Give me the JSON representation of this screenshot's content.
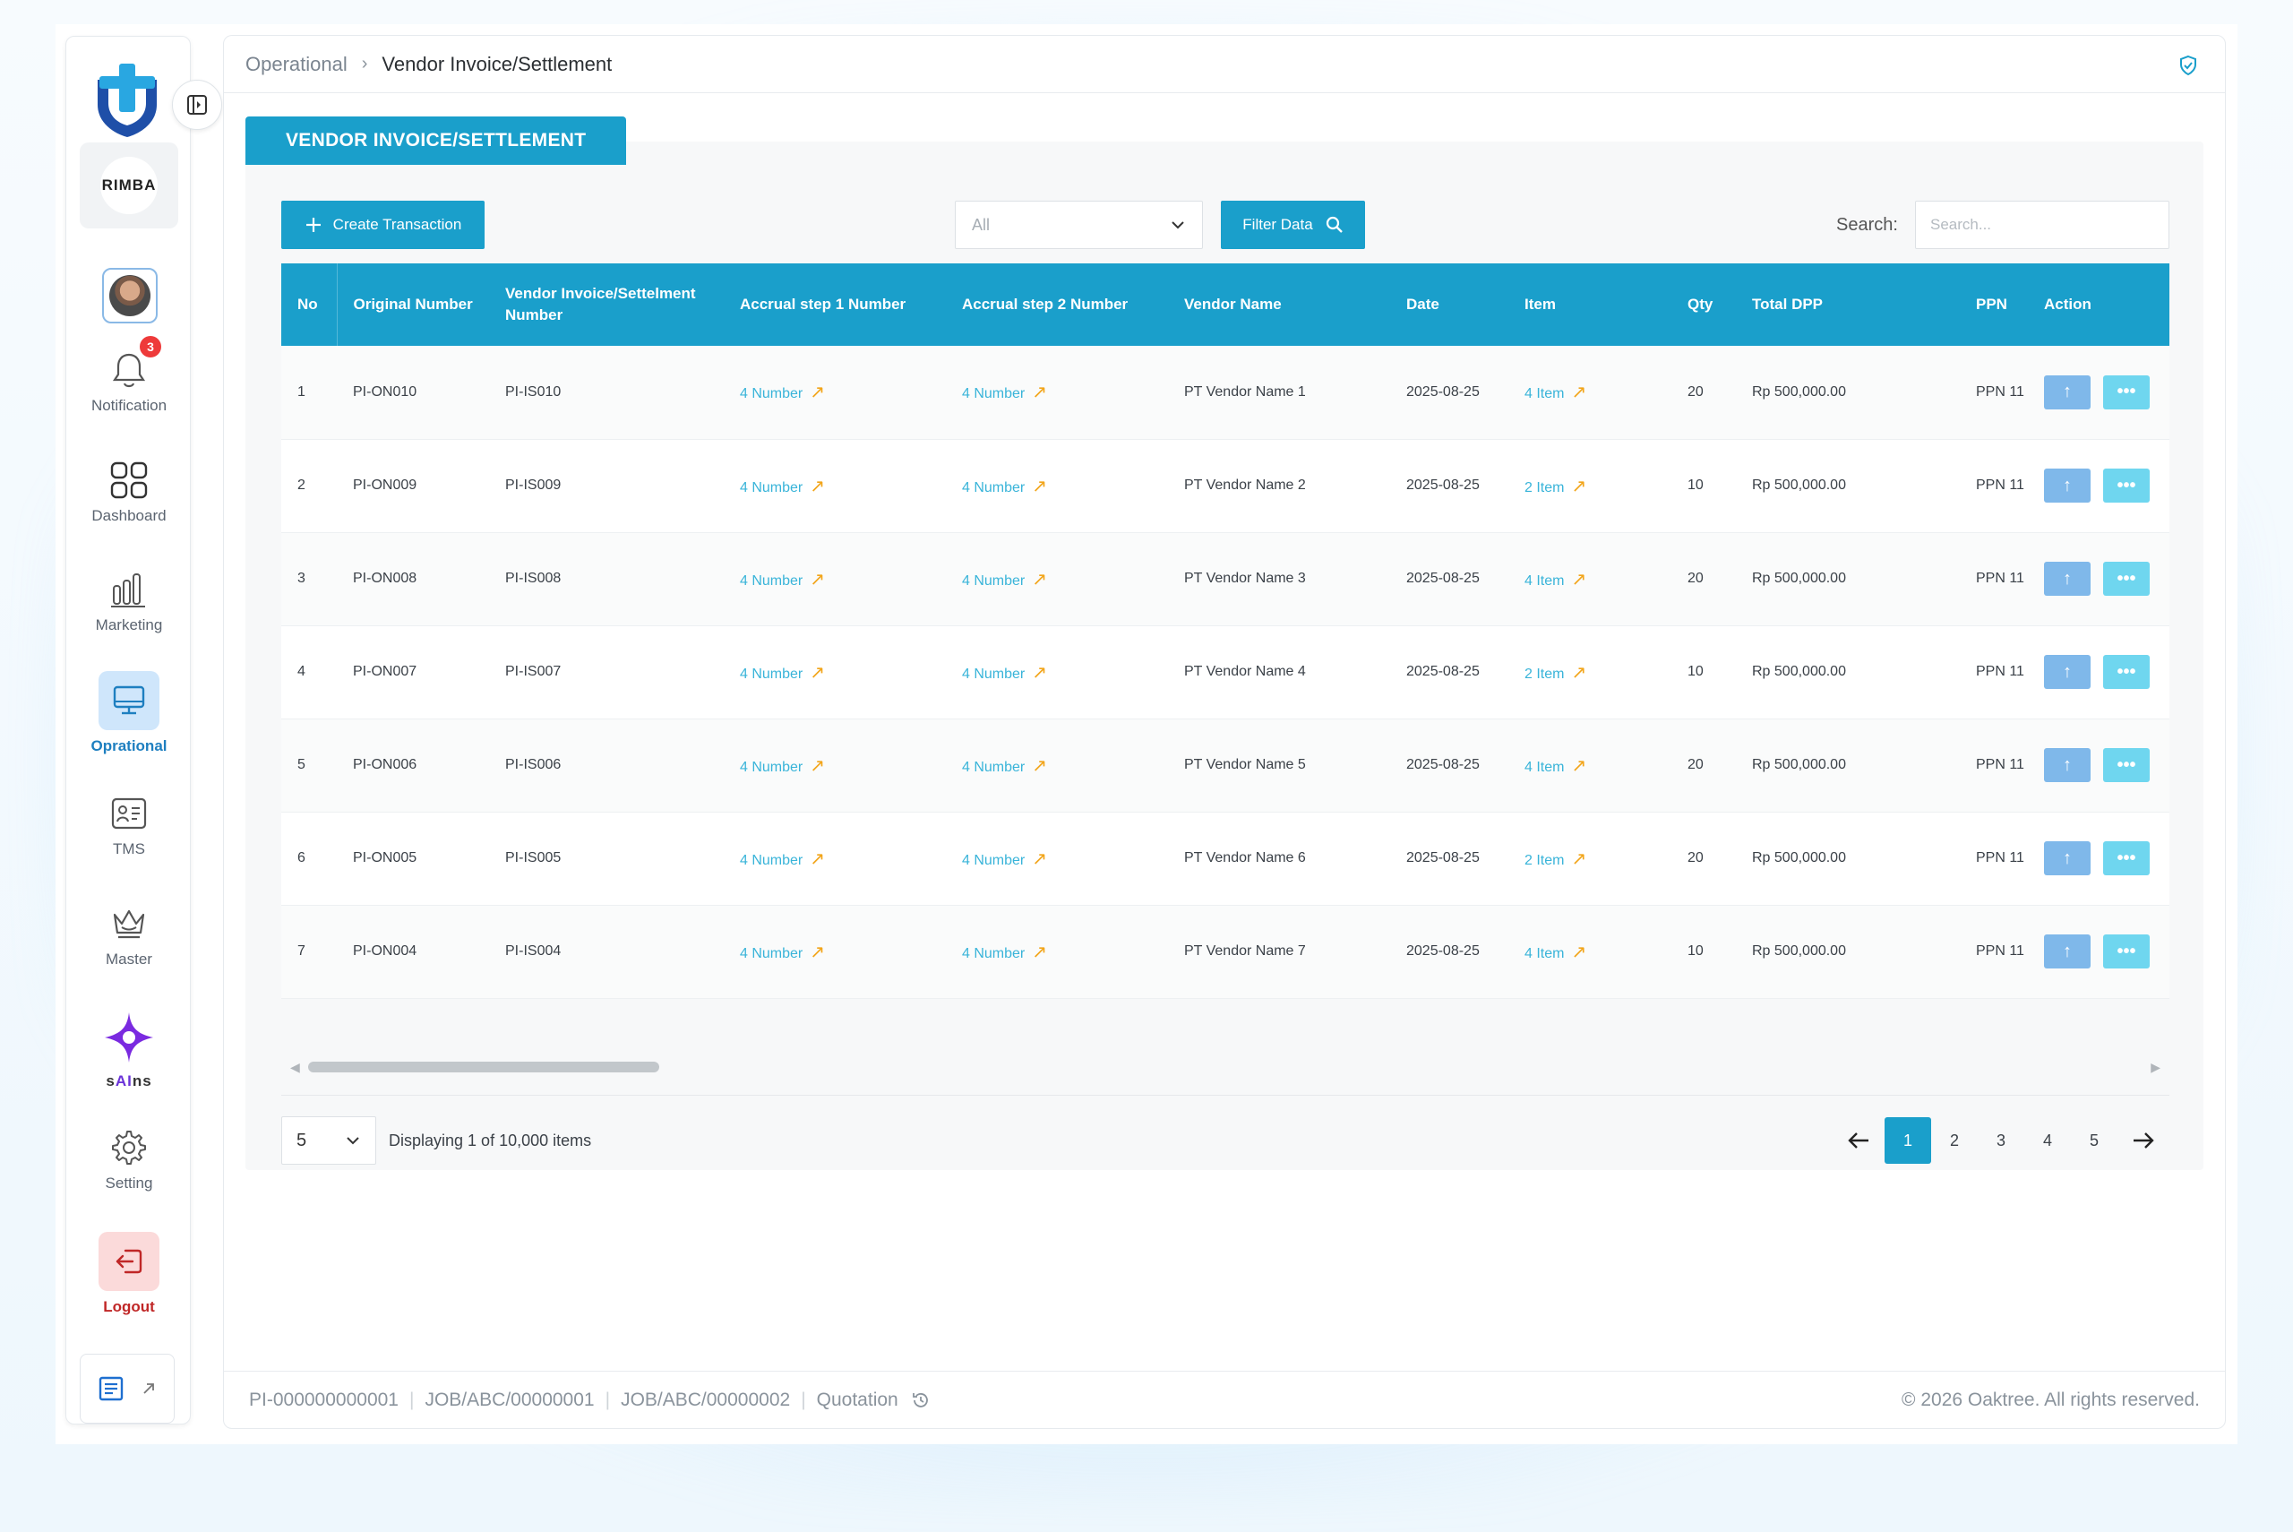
{
  "sidebar": {
    "brand_text": "RIMBA",
    "notification_count": "3",
    "items": [
      {
        "label": "Notification",
        "icon": "bell-icon"
      },
      {
        "label": "Dashboard",
        "icon": "grid-icon"
      },
      {
        "label": "Marketing",
        "icon": "bar-chart-icon"
      },
      {
        "label": "Oprational",
        "icon": "monitor-icon"
      },
      {
        "label": "TMS",
        "icon": "id-card-icon"
      },
      {
        "label": "Master",
        "icon": "crown-icon"
      },
      {
        "label_pre": "s",
        "label_ai": "AI",
        "label_post": "ns",
        "icon": "sparkle-icon"
      },
      {
        "label": "Setting",
        "icon": "gear-icon"
      },
      {
        "label": "Logout",
        "icon": "logout-icon"
      }
    ]
  },
  "breadcrumb": {
    "parent": "Operational",
    "separator": "›",
    "current": "Vendor Invoice/Settlement"
  },
  "page_tab": "VENDOR INVOICE/SETTLEMENT",
  "toolbar": {
    "create_label": "Create Transaction",
    "filter_select": "All",
    "filter_label": "Filter Data",
    "search_label": "Search:",
    "search_placeholder": "Search..."
  },
  "table": {
    "headers": [
      "No",
      "Original Number",
      "Vendor Invoice/Settelment Number",
      "Accrual step 1 Number",
      "Accrual step 2 Number",
      "Vendor Name",
      "Date",
      "Item",
      "Qty",
      "Total DPP",
      "PPN",
      "Action"
    ],
    "rows": [
      {
        "no": "1",
        "original": "PI-ON010",
        "vendor_inv": "PI-IS010",
        "acc1": "4 Number",
        "acc2": "4 Number",
        "vendor": "PT Vendor Name 1",
        "date": "2025-08-25",
        "item": "4 Item",
        "qty": "20",
        "dpp": "Rp 500,000.00",
        "ppn": "PPN 11"
      },
      {
        "no": "2",
        "original": "PI-ON009",
        "vendor_inv": "PI-IS009",
        "acc1": "4 Number",
        "acc2": "4 Number",
        "vendor": "PT Vendor Name 2",
        "date": "2025-08-25",
        "item": "2 Item",
        "qty": "10",
        "dpp": "Rp 500,000.00",
        "ppn": "PPN 11"
      },
      {
        "no": "3",
        "original": "PI-ON008",
        "vendor_inv": "PI-IS008",
        "acc1": "4 Number",
        "acc2": "4 Number",
        "vendor": "PT Vendor Name 3",
        "date": "2025-08-25",
        "item": "4 Item",
        "qty": "20",
        "dpp": "Rp 500,000.00",
        "ppn": "PPN 11"
      },
      {
        "no": "4",
        "original": "PI-ON007",
        "vendor_inv": "PI-IS007",
        "acc1": "4 Number",
        "acc2": "4 Number",
        "vendor": "PT Vendor Name 4",
        "date": "2025-08-25",
        "item": "2 Item",
        "qty": "10",
        "dpp": "Rp 500,000.00",
        "ppn": "PPN 11"
      },
      {
        "no": "5",
        "original": "PI-ON006",
        "vendor_inv": "PI-IS006",
        "acc1": "4 Number",
        "acc2": "4 Number",
        "vendor": "PT Vendor Name 5",
        "date": "2025-08-25",
        "item": "4 Item",
        "qty": "20",
        "dpp": "Rp 500,000.00",
        "ppn": "PPN 11"
      },
      {
        "no": "6",
        "original": "PI-ON005",
        "vendor_inv": "PI-IS005",
        "acc1": "4 Number",
        "acc2": "4 Number",
        "vendor": "PT Vendor Name 6",
        "date": "2025-08-25",
        "item": "2 Item",
        "qty": "20",
        "dpp": "Rp 500,000.00",
        "ppn": "PPN 11"
      },
      {
        "no": "7",
        "original": "PI-ON004",
        "vendor_inv": "PI-IS004",
        "acc1": "4 Number",
        "acc2": "4 Number",
        "vendor": "PT Vendor Name 7",
        "date": "2025-08-25",
        "item": "4 Item",
        "qty": "10",
        "dpp": "Rp 500,000.00",
        "ppn": "PPN 11"
      }
    ]
  },
  "pagination": {
    "page_size": "5",
    "info": "Displaying 1 of 10,000 items",
    "pages": [
      "1",
      "2",
      "3",
      "4",
      "5"
    ],
    "current": "1"
  },
  "footer": {
    "links": [
      "PI-000000000001",
      "JOB/ABC/00000001",
      "JOB/ABC/00000002",
      "Quotation"
    ],
    "copyright": "© 2026 Oaktree. All rights reserved."
  },
  "colors": {
    "primary": "#1a9fcb",
    "link": "#39b4d9",
    "arrow": "#f2a51a",
    "action_up": "#7fb8ea",
    "action_more": "#6fd6ef",
    "logout": "#c02727",
    "badge": "#ee3a3a"
  }
}
